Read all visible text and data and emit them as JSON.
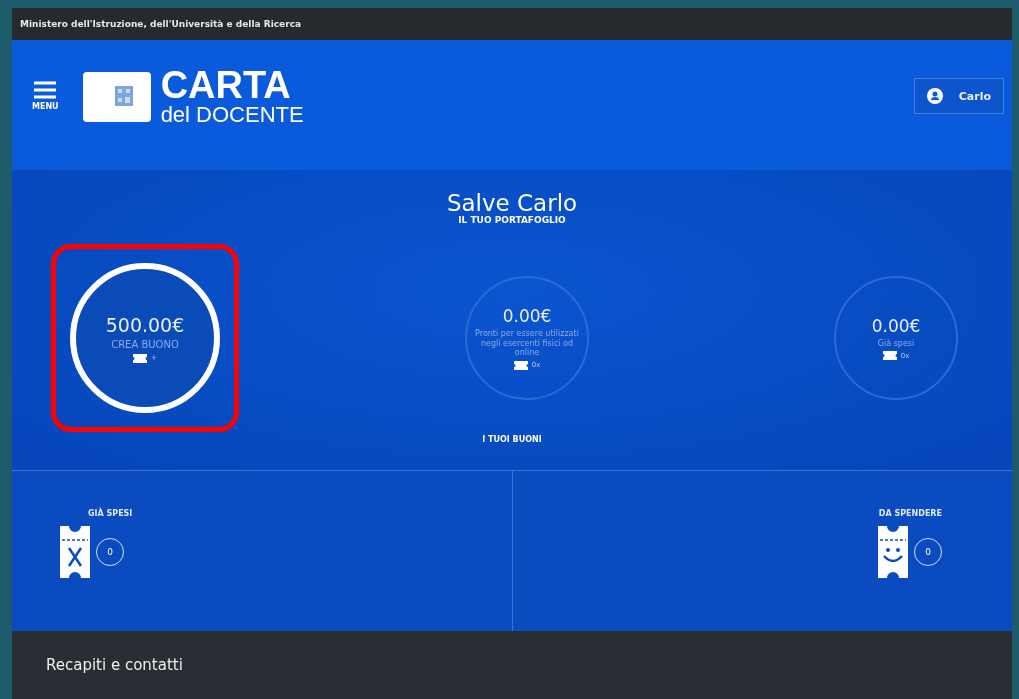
{
  "top_bar": {
    "title": "Ministero dell'Istruzione, dell'Università e della Ricerca"
  },
  "header": {
    "menu_label": "MENU",
    "logo_title": "CARTA",
    "logo_subtitle": "del DOCENTE",
    "user": "Carlo"
  },
  "greeting": {
    "title": "Salve Carlo",
    "subtitle": "IL TUO PORTAFOGLIO"
  },
  "wallets": [
    {
      "kind": "create",
      "amount": "500.00€",
      "caption": "CREA BUONO",
      "badge": "+",
      "highlighted": true
    },
    {
      "kind": "summary",
      "amount": "0.00€",
      "caption": "Pronti per essere utilizzati negli esercenti fisici od online",
      "badge": "0x",
      "highlighted": false
    },
    {
      "kind": "summary",
      "amount": "0.00€",
      "caption": "Già spesi",
      "badge": "0x",
      "highlighted": false
    }
  ],
  "vouchers_label": "I TUOI BUONI",
  "panels": [
    {
      "kind": "spent",
      "label": "GIÀ SPESI",
      "count": "0"
    },
    {
      "kind": "to_spend",
      "label": "DA SPENDERE",
      "count": "0"
    }
  ],
  "footer": {
    "title": "Recapiti e contatti"
  }
}
